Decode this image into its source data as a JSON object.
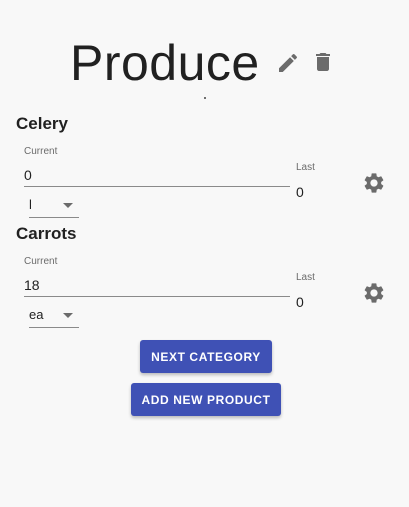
{
  "header": {
    "title": "Produce",
    "edit_icon": "pencil-icon",
    "delete_icon": "trash-icon"
  },
  "products": [
    {
      "name": "Celery",
      "current_label": "Current",
      "current_value": "0",
      "last_label": "Last",
      "last_value": "0",
      "unit": "l",
      "settings_icon": "gear-icon"
    },
    {
      "name": "Carrots",
      "current_label": "Current",
      "current_value": "18",
      "last_label": "Last",
      "last_value": "0",
      "unit": "ea",
      "settings_icon": "gear-icon"
    }
  ],
  "actions": {
    "next_category_label": "NEXT CATEGORY",
    "add_product_label": "ADD NEW PRODUCT"
  },
  "colors": {
    "primary": "#3f51b5",
    "icon": "#6b6b6b",
    "background": "#f8f8f8"
  }
}
